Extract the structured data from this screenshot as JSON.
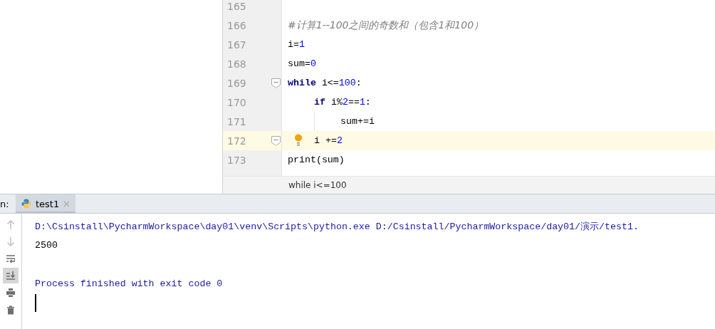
{
  "editor": {
    "lines": [
      {
        "number": "165",
        "current": false
      },
      {
        "number": "166",
        "current": false,
        "tokens": [
          {
            "kind": "comment",
            "text": "#计算1--100之间的奇数和（包含1和100）"
          }
        ]
      },
      {
        "number": "167",
        "current": false,
        "tokens": [
          {
            "kind": "plain",
            "text": "i="
          },
          {
            "kind": "number",
            "text": "1"
          }
        ]
      },
      {
        "number": "168",
        "current": false,
        "tokens": [
          {
            "kind": "plain",
            "text": "sum="
          },
          {
            "kind": "number",
            "text": "0"
          }
        ]
      },
      {
        "number": "169",
        "current": false,
        "fold": true,
        "tokens": [
          {
            "kind": "keyword",
            "text": "while"
          },
          {
            "kind": "plain",
            "text": " i<="
          },
          {
            "kind": "number",
            "text": "100"
          },
          {
            "kind": "plain",
            "text": ":"
          }
        ],
        "children": [
          {
            "number": "170",
            "current": false,
            "tokens": [
              {
                "kind": "keyword",
                "text": "if"
              },
              {
                "kind": "plain",
                "text": " i%"
              },
              {
                "kind": "number",
                "text": "2"
              },
              {
                "kind": "plain",
                "text": "=="
              },
              {
                "kind": "number",
                "text": "1"
              },
              {
                "kind": "plain",
                "text": ":"
              }
            ],
            "children": [
              {
                "number": "171",
                "current": false,
                "tokens": [
                  {
                    "kind": "plain",
                    "text": "sum+=i"
                  }
                ]
              }
            ]
          },
          {
            "number": "172",
            "current": true,
            "fold": true,
            "bulb": true,
            "tokens": [
              {
                "kind": "plain",
                "text": "i +="
              },
              {
                "kind": "number",
                "text": "2"
              }
            ]
          }
        ]
      },
      {
        "number": "173",
        "current": false,
        "tokens": [
          {
            "kind": "plain",
            "text": "print(sum)"
          }
        ]
      }
    ],
    "breadcrumb": "while i<=100"
  },
  "run_panel": {
    "label": "n:",
    "tabs": [
      {
        "label": "test1",
        "selected": true
      }
    ],
    "toolbar": [
      {
        "kind": "up",
        "disabled": true,
        "selected": false
      },
      {
        "kind": "down",
        "disabled": true,
        "selected": false
      },
      {
        "kind": "wrap",
        "disabled": false,
        "selected": false
      },
      {
        "kind": "scroll-end",
        "disabled": false,
        "selected": true
      },
      {
        "kind": "print",
        "disabled": false,
        "selected": false
      },
      {
        "kind": "trash",
        "disabled": false,
        "selected": false
      }
    ],
    "console": [
      {
        "kind": "command",
        "text": "D:\\Csinstall\\PycharmWorkspace\\day01\\venv\\Scripts\\python.exe D:/Csinstall/PycharmWorkspace/day01/演示/test1."
      },
      {
        "kind": "output",
        "text": "2500"
      },
      {
        "kind": "blank"
      },
      {
        "kind": "info",
        "text": "Process finished with exit code 0"
      },
      {
        "kind": "cursor"
      }
    ]
  }
}
